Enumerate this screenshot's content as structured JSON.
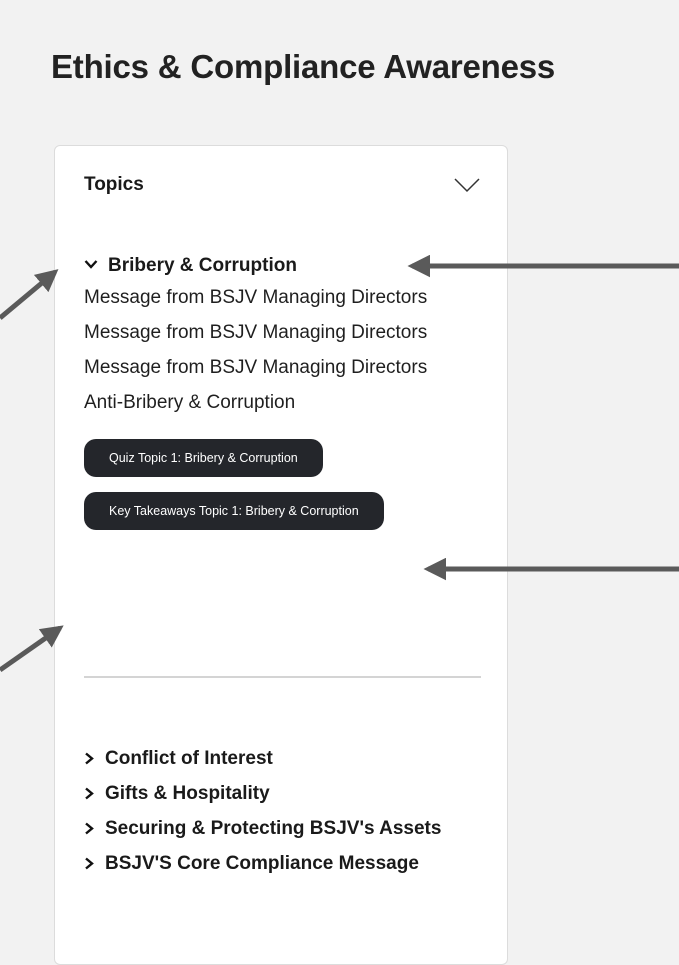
{
  "page": {
    "title": "Ethics & Compliance Awareness"
  },
  "topics_panel": {
    "header": "Topics",
    "header_icon": "chevron-down-icon",
    "expanded_section": {
      "title": "Bribery & Corruption",
      "icon": "chevron-down-icon",
      "items": [
        "Message from BSJV Managing Directors",
        "Message from BSJV Managing Directors",
        "Message from BSJV Managing Directors",
        "Anti-Bribery & Corruption"
      ],
      "buttons": [
        "Quiz Topic 1: Bribery & Corruption",
        "Key Takeaways Topic 1: Bribery & Corruption"
      ]
    },
    "collapsed_sections": [
      "Conflict of Interest",
      "Gifts & Hospitality",
      "Securing & Protecting BSJV's Assets",
      "BSJV'S Core Compliance Message"
    ],
    "collapsed_icon": "chevron-right-icon"
  },
  "annotations": {
    "arrow_color": "#5a5a5a"
  }
}
